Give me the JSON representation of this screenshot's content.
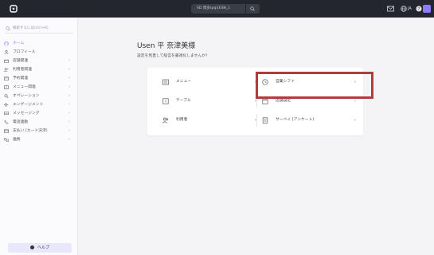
{
  "topbar": {
    "store_name": "SD 博多(pq)(ESN_1",
    "user_initials": "JA",
    "accent_color": "#8e7cf5",
    "icons": [
      "app-logo-icon",
      "search-icon",
      "mail-icon",
      "globe-icon",
      "help-circle-icon"
    ]
  },
  "sidebar": {
    "search_placeholder": "検索するには(ctrl+K)",
    "items": [
      {
        "label": "ホーム",
        "active": true
      },
      {
        "label": "プロフィール",
        "active": false
      },
      {
        "label": "店舗関連",
        "active": false
      },
      {
        "label": "利用者関連",
        "active": false
      },
      {
        "label": "予約関連",
        "active": false
      },
      {
        "label": "メニュー関連",
        "active": false
      },
      {
        "label": "オペレーション",
        "active": false
      },
      {
        "label": "エンゲージメント",
        "active": false
      },
      {
        "label": "メッセージング",
        "active": false
      },
      {
        "label": "電話連動",
        "active": false
      },
      {
        "label": "支払い (カード決済)",
        "active": false
      },
      {
        "label": "連携",
        "active": false
      }
    ],
    "help_label": "ヘルプ"
  },
  "main": {
    "greeting": "Usen 平 奈津美様",
    "subtitle": "設定を見直して経営を最適化しませんか？",
    "cards": [
      {
        "label": "メニュー",
        "icon": "menu-icon"
      },
      {
        "label": "営業シフト",
        "icon": "clock-icon"
      },
      {
        "label": "テーブル",
        "icon": "table-icon"
      },
      {
        "label": "店舗設定",
        "icon": "store-icon"
      },
      {
        "label": "利用者",
        "icon": "users-icon"
      },
      {
        "label": "サーベイ (アンケート)",
        "icon": "survey-icon"
      }
    ]
  },
  "highlight_color": "#b53a3a"
}
